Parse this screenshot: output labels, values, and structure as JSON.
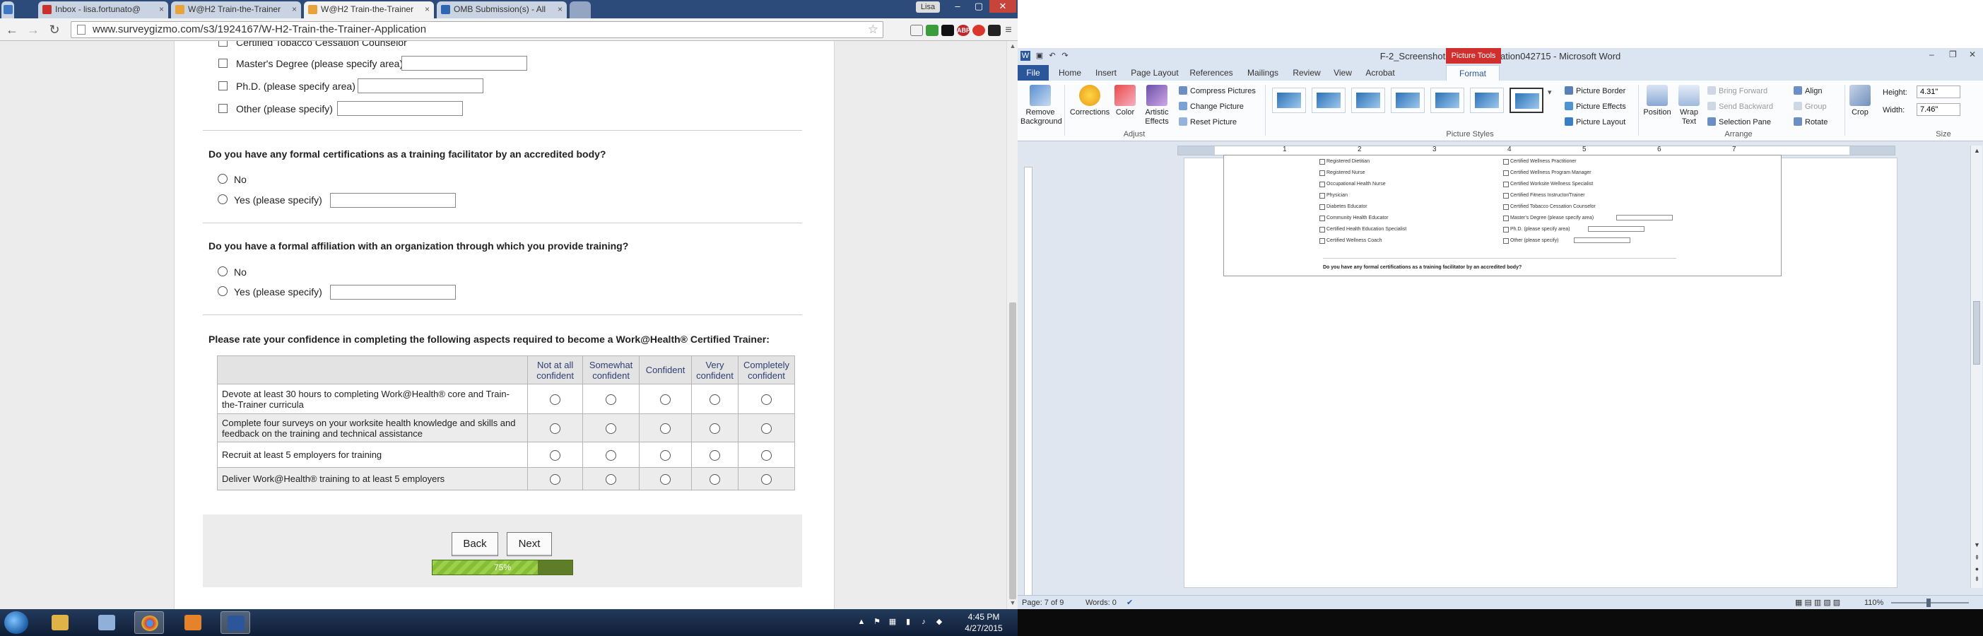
{
  "browser": {
    "tabs": [
      {
        "label": "Inbox - lisa.fortunato@",
        "favicon_color": "#c9302c"
      },
      {
        "label": "W@H2 Train-the-Trainer",
        "favicon_color": "#e8a33c"
      },
      {
        "label": "W@H2 Train-the-Trainer",
        "favicon_color": "#e8a33c"
      },
      {
        "label": "OMB Submission(s) - All",
        "favicon_color": "#2e66b3"
      }
    ],
    "profile_name": "Lisa",
    "url": "www.surveygizmo.com/s3/1924167/W-H2-Train-the-Trainer-Application",
    "extensions": [
      {
        "label": "ABP",
        "color": "#c0282d"
      },
      {
        "label": "C",
        "color": "#d9372c"
      },
      {
        "label": "S",
        "color": "#222222"
      },
      {
        "label": "G",
        "color": "#c43b34"
      }
    ]
  },
  "survey": {
    "prev_options": [
      {
        "label": "Certified Tobacco Cessation Counselor",
        "has_field": false
      },
      {
        "label": "Master's Degree (please specify area)",
        "has_field": true
      },
      {
        "label": "Ph.D. (please specify area)",
        "has_field": true
      },
      {
        "label": "Other (please specify)",
        "has_field": true
      }
    ],
    "q_cert": {
      "question": "Do you have any formal certifications as a training facilitator by an accredited body?",
      "options": [
        "No",
        "Yes (please specify)"
      ]
    },
    "q_affil": {
      "question": "Do you have a formal affiliation with an organization through which you provide training?",
      "options": [
        "No",
        "Yes (please specify)"
      ]
    },
    "q_conf": {
      "question": "Please rate your confidence in completing the following aspects required to become a Work@Health® Certified Trainer:",
      "columns": [
        "Not at all confident",
        "Somewhat confident",
        "Confident",
        "Very confident",
        "Completely confident"
      ],
      "rows": [
        "Devote at least 30 hours to completing Work@Health® core and Train-the-Trainer curricula",
        "Complete four surveys on your worksite health knowledge and skills and feedback on the training and technical assistance",
        "Recruit at least 5 employers for training",
        "Deliver Work@Health® training to at least 5 employers"
      ]
    },
    "back_label": "Back",
    "next_label": "Next",
    "progress_label": "75%",
    "progress_fraction": 0.75
  },
  "word": {
    "title": "F-2_Screenshots of T3 Application042715 - Microsoft Word",
    "context_tab": "Picture Tools",
    "tabs": [
      "File",
      "Home",
      "Insert",
      "Page Layout",
      "References",
      "Mailings",
      "Review",
      "View",
      "Acrobat",
      "Format"
    ],
    "ribbon": {
      "remove_bg": "Remove Background",
      "corrections": "Corrections",
      "color": "Color",
      "artistic": "Artistic Effects",
      "compress": "Compress Pictures",
      "change": "Change Picture",
      "reset": "Reset Picture",
      "group_adjust": "Adjust",
      "group_styles": "Picture Styles",
      "border": "Picture Border",
      "effects": "Picture Effects",
      "layout": "Picture Layout",
      "position": "Position",
      "wrap": "Wrap Text",
      "bring_forward": "Bring Forward",
      "send_backward": "Send Backward",
      "selection_pane": "Selection Pane",
      "align": "Align",
      "group": "Group",
      "rotate": "Rotate",
      "group_arrange": "Arrange",
      "crop": "Crop",
      "height_label": "Height:",
      "height_value": "4.31\"",
      "width_label": "Width:",
      "width_value": "7.46\"",
      "group_size": "Size"
    },
    "ruler_numbers": [
      "1",
      "2",
      "3",
      "4",
      "5",
      "6",
      "7"
    ],
    "pic_items": [
      "Registered Dietitian",
      "Registered Nurse",
      "Occupational Health Nurse",
      "Physician",
      "Diabetes Educator",
      "Community Health Educator",
      "Certified Health Education Specialist",
      "Certified Wellness Coach",
      "Certified Wellness Practitioner",
      "Certified Wellness Program Manager",
      "Certified Worksite Wellness Specialist",
      "Certified Fitness Instructor/Trainer",
      "Certified Tobacco Cessation Counselor",
      "Master's Degree (please specify area)",
      "Ph.D. (please specify area)",
      "Other (please specify)"
    ],
    "pic_question": "Do you have any formal certifications as a training facilitator by an accredited body?",
    "status_page": "Page: 7 of 9",
    "status_words": "Words: 0",
    "zoom": "110%"
  },
  "taskbar": {
    "apps": [
      {
        "name": "explorer",
        "color": "#e0b346"
      },
      {
        "name": "calculator",
        "color": "#8fb0d9"
      },
      {
        "name": "chrome",
        "color": "#d7402f"
      },
      {
        "name": "outlook",
        "color": "#e5822a"
      },
      {
        "name": "word",
        "color": "#2b579a"
      }
    ],
    "time": "4:45 PM",
    "date": "4/27/2015"
  }
}
